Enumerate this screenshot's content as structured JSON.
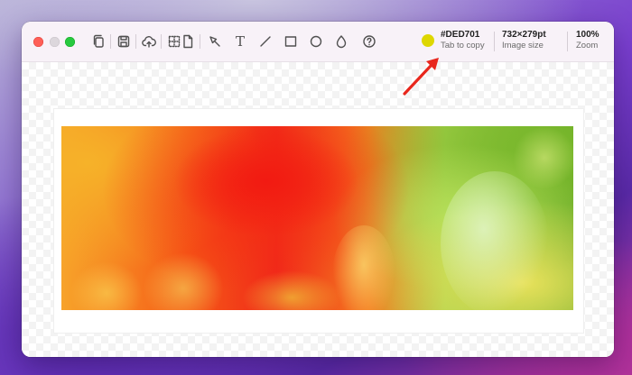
{
  "toolbar": {
    "tools": [
      "copy-icon",
      "save-icon",
      "upload-icon",
      "dotted-grid-icon",
      "page-icon",
      "pen-icon",
      "text-icon",
      "line-icon",
      "rectangle-icon",
      "ellipse-icon",
      "fill-drop-icon",
      "help-icon"
    ],
    "text_tool_glyph": "T",
    "color": {
      "hex": "#DED701",
      "hint": "Tab to copy"
    },
    "image_size": {
      "value": "732×279pt",
      "label": "Image size"
    },
    "zoom": {
      "value": "100%",
      "label": "Zoom"
    }
  },
  "colors": {
    "picked": "#DED701",
    "arrow": "#e8261c"
  }
}
